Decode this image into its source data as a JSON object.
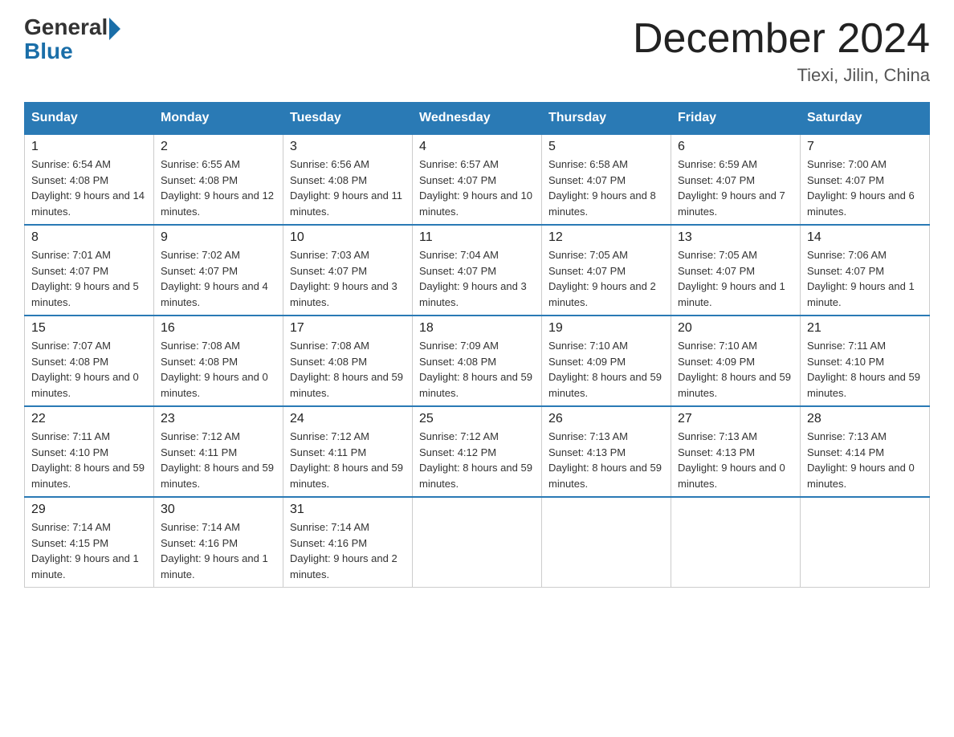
{
  "header": {
    "logo_line1": "General",
    "logo_line2": "Blue",
    "title": "December 2024",
    "subtitle": "Tiexi, Jilin, China"
  },
  "days_of_week": [
    "Sunday",
    "Monday",
    "Tuesday",
    "Wednesday",
    "Thursday",
    "Friday",
    "Saturday"
  ],
  "weeks": [
    [
      {
        "day": "1",
        "sunrise": "6:54 AM",
        "sunset": "4:08 PM",
        "daylight": "9 hours and 14 minutes."
      },
      {
        "day": "2",
        "sunrise": "6:55 AM",
        "sunset": "4:08 PM",
        "daylight": "9 hours and 12 minutes."
      },
      {
        "day": "3",
        "sunrise": "6:56 AM",
        "sunset": "4:08 PM",
        "daylight": "9 hours and 11 minutes."
      },
      {
        "day": "4",
        "sunrise": "6:57 AM",
        "sunset": "4:07 PM",
        "daylight": "9 hours and 10 minutes."
      },
      {
        "day": "5",
        "sunrise": "6:58 AM",
        "sunset": "4:07 PM",
        "daylight": "9 hours and 8 minutes."
      },
      {
        "day": "6",
        "sunrise": "6:59 AM",
        "sunset": "4:07 PM",
        "daylight": "9 hours and 7 minutes."
      },
      {
        "day": "7",
        "sunrise": "7:00 AM",
        "sunset": "4:07 PM",
        "daylight": "9 hours and 6 minutes."
      }
    ],
    [
      {
        "day": "8",
        "sunrise": "7:01 AM",
        "sunset": "4:07 PM",
        "daylight": "9 hours and 5 minutes."
      },
      {
        "day": "9",
        "sunrise": "7:02 AM",
        "sunset": "4:07 PM",
        "daylight": "9 hours and 4 minutes."
      },
      {
        "day": "10",
        "sunrise": "7:03 AM",
        "sunset": "4:07 PM",
        "daylight": "9 hours and 3 minutes."
      },
      {
        "day": "11",
        "sunrise": "7:04 AM",
        "sunset": "4:07 PM",
        "daylight": "9 hours and 3 minutes."
      },
      {
        "day": "12",
        "sunrise": "7:05 AM",
        "sunset": "4:07 PM",
        "daylight": "9 hours and 2 minutes."
      },
      {
        "day": "13",
        "sunrise": "7:05 AM",
        "sunset": "4:07 PM",
        "daylight": "9 hours and 1 minute."
      },
      {
        "day": "14",
        "sunrise": "7:06 AM",
        "sunset": "4:07 PM",
        "daylight": "9 hours and 1 minute."
      }
    ],
    [
      {
        "day": "15",
        "sunrise": "7:07 AM",
        "sunset": "4:08 PM",
        "daylight": "9 hours and 0 minutes."
      },
      {
        "day": "16",
        "sunrise": "7:08 AM",
        "sunset": "4:08 PM",
        "daylight": "9 hours and 0 minutes."
      },
      {
        "day": "17",
        "sunrise": "7:08 AM",
        "sunset": "4:08 PM",
        "daylight": "8 hours and 59 minutes."
      },
      {
        "day": "18",
        "sunrise": "7:09 AM",
        "sunset": "4:08 PM",
        "daylight": "8 hours and 59 minutes."
      },
      {
        "day": "19",
        "sunrise": "7:10 AM",
        "sunset": "4:09 PM",
        "daylight": "8 hours and 59 minutes."
      },
      {
        "day": "20",
        "sunrise": "7:10 AM",
        "sunset": "4:09 PM",
        "daylight": "8 hours and 59 minutes."
      },
      {
        "day": "21",
        "sunrise": "7:11 AM",
        "sunset": "4:10 PM",
        "daylight": "8 hours and 59 minutes."
      }
    ],
    [
      {
        "day": "22",
        "sunrise": "7:11 AM",
        "sunset": "4:10 PM",
        "daylight": "8 hours and 59 minutes."
      },
      {
        "day": "23",
        "sunrise": "7:12 AM",
        "sunset": "4:11 PM",
        "daylight": "8 hours and 59 minutes."
      },
      {
        "day": "24",
        "sunrise": "7:12 AM",
        "sunset": "4:11 PM",
        "daylight": "8 hours and 59 minutes."
      },
      {
        "day": "25",
        "sunrise": "7:12 AM",
        "sunset": "4:12 PM",
        "daylight": "8 hours and 59 minutes."
      },
      {
        "day": "26",
        "sunrise": "7:13 AM",
        "sunset": "4:13 PM",
        "daylight": "8 hours and 59 minutes."
      },
      {
        "day": "27",
        "sunrise": "7:13 AM",
        "sunset": "4:13 PM",
        "daylight": "9 hours and 0 minutes."
      },
      {
        "day": "28",
        "sunrise": "7:13 AM",
        "sunset": "4:14 PM",
        "daylight": "9 hours and 0 minutes."
      }
    ],
    [
      {
        "day": "29",
        "sunrise": "7:14 AM",
        "sunset": "4:15 PM",
        "daylight": "9 hours and 1 minute."
      },
      {
        "day": "30",
        "sunrise": "7:14 AM",
        "sunset": "4:16 PM",
        "daylight": "9 hours and 1 minute."
      },
      {
        "day": "31",
        "sunrise": "7:14 AM",
        "sunset": "4:16 PM",
        "daylight": "9 hours and 2 minutes."
      },
      null,
      null,
      null,
      null
    ]
  ]
}
